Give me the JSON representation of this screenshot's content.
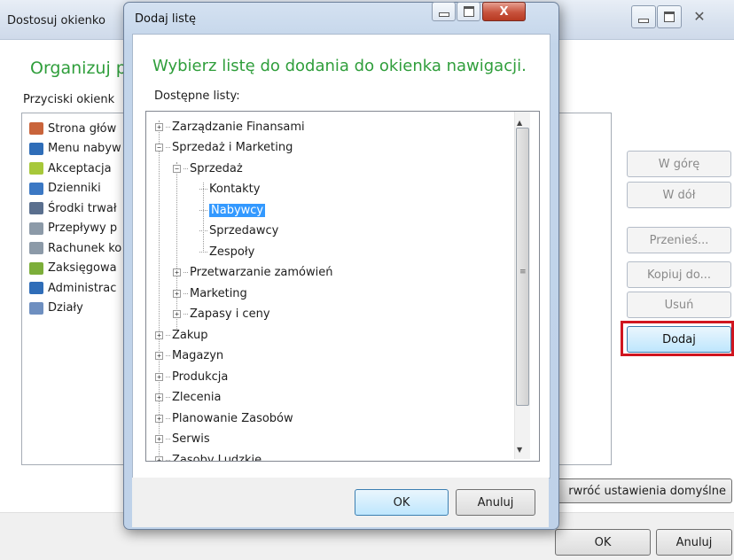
{
  "back_window": {
    "title": "Dostosuj okienko",
    "heading": "Organizuj pr",
    "list_label": "Przyciski okienk",
    "items": [
      {
        "label": "Strona głów",
        "icon": "home-icon",
        "color": "#c9643b"
      },
      {
        "label": "Menu nabyw",
        "icon": "users-icon",
        "color": "#2f6db8"
      },
      {
        "label": "Akceptacja",
        "icon": "approve-icon",
        "color": "#a7c83a"
      },
      {
        "label": "Dzienniki",
        "icon": "journal-icon",
        "color": "#3b78c4"
      },
      {
        "label": "Środki trwał",
        "icon": "asset-icon",
        "color": "#5a6f8e"
      },
      {
        "label": "Przepływy p",
        "icon": "report-icon",
        "color": "#8c9aa8"
      },
      {
        "label": "Rachunek ko",
        "icon": "report-icon",
        "color": "#8c9aa8"
      },
      {
        "label": "Zaksięgowa",
        "icon": "posted-icon",
        "color": "#7cae3a"
      },
      {
        "label": "Administrac",
        "icon": "admin-icon",
        "color": "#2f6db8"
      },
      {
        "label": "Działy",
        "icon": "departments-icon",
        "color": "#6e8fc0"
      }
    ],
    "buttons": {
      "up": "W górę",
      "down": "W dół",
      "move": "Przenieś...",
      "copy": "Kopiuj do...",
      "delete": "Usuń",
      "add": "Dodaj",
      "restore_defaults": "rwróć ustawienia domyślne",
      "ok": "OK",
      "cancel": "Anuluj"
    }
  },
  "dialog": {
    "title": "Dodaj listę",
    "heading": "Wybierz listę do dodania do okienka nawigacji.",
    "sublabel": "Dostępne listy:",
    "tree": [
      {
        "label": "Zarządzanie Finansami",
        "level": 0,
        "state": "collapsed"
      },
      {
        "label": "Sprzedaż i Marketing",
        "level": 0,
        "state": "expanded"
      },
      {
        "label": "Sprzedaż",
        "level": 1,
        "state": "expanded"
      },
      {
        "label": "Kontakty",
        "level": 2,
        "state": "leaf"
      },
      {
        "label": "Nabywcy",
        "level": 2,
        "state": "leaf",
        "selected": true
      },
      {
        "label": "Sprzedawcy",
        "level": 2,
        "state": "leaf"
      },
      {
        "label": "Zespoły",
        "level": 2,
        "state": "leaf"
      },
      {
        "label": "Przetwarzanie zamówień",
        "level": 1,
        "state": "collapsed"
      },
      {
        "label": "Marketing",
        "level": 1,
        "state": "collapsed"
      },
      {
        "label": "Zapasy i ceny",
        "level": 1,
        "state": "collapsed"
      },
      {
        "label": "Zakup",
        "level": 0,
        "state": "collapsed"
      },
      {
        "label": "Magazyn",
        "level": 0,
        "state": "collapsed"
      },
      {
        "label": "Produkcja",
        "level": 0,
        "state": "collapsed"
      },
      {
        "label": "Zlecenia",
        "level": 0,
        "state": "collapsed"
      },
      {
        "label": "Planowanie Zasobów",
        "level": 0,
        "state": "collapsed"
      },
      {
        "label": "Serwis",
        "level": 0,
        "state": "collapsed"
      },
      {
        "label": "Zasoby Ludzkie",
        "level": 0,
        "state": "collapsed"
      }
    ],
    "buttons": {
      "ok": "OK",
      "cancel": "Anuluj",
      "close_glyph": "X"
    }
  },
  "colors": {
    "heading_green": "#2f9e3b",
    "selection_blue": "#3399ff",
    "highlight_red": "#d0151f"
  }
}
